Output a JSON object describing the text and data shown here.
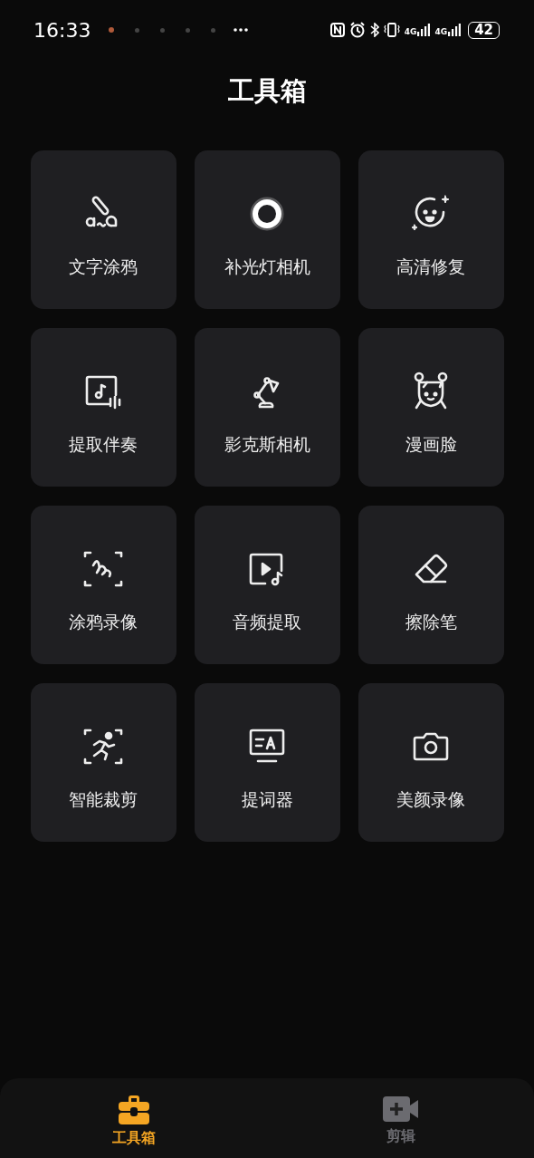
{
  "status_bar": {
    "time": "16:33",
    "network_1": "4G",
    "network_2": "4G",
    "battery": "42"
  },
  "title": "工具箱",
  "tools": [
    {
      "label": "文字涂鸦",
      "kind": "text-doodle"
    },
    {
      "label": "补光灯相机",
      "kind": "ring-light"
    },
    {
      "label": "高清修复",
      "kind": "face-sparkle"
    },
    {
      "label": "提取伴奏",
      "kind": "music-extract"
    },
    {
      "label": "影克斯相机",
      "kind": "lamp"
    },
    {
      "label": "漫画脸",
      "kind": "comic-face"
    },
    {
      "label": "涂鸦录像",
      "kind": "scribble-frame"
    },
    {
      "label": "音频提取",
      "kind": "video-music"
    },
    {
      "label": "擦除笔",
      "kind": "eraser"
    },
    {
      "label": "智能裁剪",
      "kind": "runner-frame"
    },
    {
      "label": "提词器",
      "kind": "teleprompter"
    },
    {
      "label": "美颜录像",
      "kind": "camera"
    }
  ],
  "nav": [
    {
      "label": "工具箱",
      "kind": "toolbox",
      "selected": true
    },
    {
      "label": "剪辑",
      "kind": "video-add",
      "selected": false
    }
  ]
}
